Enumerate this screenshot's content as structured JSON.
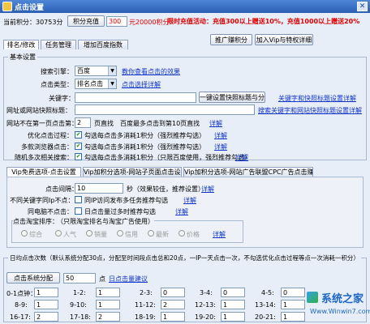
{
  "window": {
    "title": "点击设置",
    "close_glyph": "✕"
  },
  "top": {
    "points_label": "当前积分：30753分",
    "recharge_button": "积分充值",
    "recharge_amount": "300",
    "recharge_unit": "元20000积分",
    "promo": "限时充值活动：充值300以上赠送10%，充值1000以上赠送20%",
    "promo_software_button": "推广赚积分",
    "add_vip_button": "加入Vip与特权详细"
  },
  "tabs": [
    "排名/修改",
    "任务管理",
    "增加百度指数"
  ],
  "basic": {
    "group_label": "基本设置",
    "engine_label": "搜索引擎：",
    "engine_value": "百度",
    "engine_link": "教你查看点击的效果",
    "click_type_label": "点击类型：",
    "click_type_value": "排名点击",
    "click_type_link": "点击选择详解",
    "keyword_label": "关键字：",
    "keyword_button": "一键设置快照标题与分页",
    "keyword_link": "关键字和快照标题设置详解",
    "title_label": "网址或网站快照标题：",
    "title_link": "搜索关键字和网站快照标题设置详解",
    "pages_label": "网站不在第一页点击第：",
    "pages_value": "2",
    "pages_suffix": "页直找　百度最多点击到第10页直找",
    "pages_link": "详解",
    "optimize_label": "优化点击过程：",
    "optimize_text": "勾选每点击多消耗1积分（强烈推荐勾选）",
    "optimize_link": "详解",
    "multi_browser_label": "多款浏览器点击：",
    "multi_browser_text": "勾选每点击多消耗1积分（强烈推荐勾选）",
    "multi_browser_link": "详解",
    "random_label": "随机多次相关搜索：",
    "random_text": "勾选每点击多消耗1积分（只限百度使用，强烈推荐勾选）",
    "random_link": "详解",
    "check_glyph": "✔"
  },
  "vip_tabs": [
    "Vip免费选项-点击设置",
    "Vip加积分选项-网站子页面点击设置",
    "Vip加积分选项-网站广告联盟CPC广告点击赚钱"
  ],
  "vip": {
    "dwell_label": "点击间隔：",
    "dwell_value": "10",
    "dwell_suffix": "秒（效果较佳，推荐设置）",
    "dwell_link": "详解",
    "ip_label": "不同关键字同Ip不点：",
    "ip_text": "同IP访问发布多任务推荐勾选",
    "ip_link": "详解",
    "sameday_label": "同电脑不点击：",
    "sameday_text": "日点击量过多时推荐勾选",
    "sameday_link": "详解",
    "sort_label": "点击淘宝排序：",
    "sort_note": "（只限淘宝排名与淘宝广告使用）",
    "sort_options": [
      "综合",
      "人气",
      "销量",
      "信用",
      "最新",
      "价格"
    ],
    "sort_link": "详解"
  },
  "daily": {
    "group_label": "日均点击次数（默认系统分配30点，分配至时间段点击总和20点，一IP一天点击一次，不勾选优化点击过程等点一次消耗一积分）",
    "auto_button": "点击系统分配",
    "auto_value": "50",
    "auto_suffix": "点",
    "auto_link": "日点击量建议",
    "slots": [
      {
        "label": "0-1点钟：",
        "value": "1"
      },
      {
        "label": "1-2:",
        "value": "1"
      },
      {
        "label": "2-3:",
        "value": "0"
      },
      {
        "label": "3-4:",
        "value": "0"
      },
      {
        "label": "4-5:",
        "value": "0"
      },
      {
        "label": "8-9:",
        "value": "1"
      },
      {
        "label": "9-10:",
        "value": "1"
      },
      {
        "label": "11-12:",
        "value": "2"
      },
      {
        "label": "12-13:",
        "value": "1"
      },
      {
        "label": "13-14:",
        "value": "1"
      },
      {
        "label": "16-17:",
        "value": "2"
      },
      {
        "label": "17-18:",
        "value": "2"
      },
      {
        "label": "18-19:",
        "value": "1"
      },
      {
        "label": "19-20:",
        "value": "1"
      },
      {
        "label": "20-21:",
        "value": "1"
      }
    ]
  },
  "watermark": {
    "site": "系统之家",
    "url": "Www.Winwin7.com"
  },
  "colors": {
    "titlebar": "#2a5fb5",
    "promo": "#e00000",
    "link": "#1136c9",
    "background": "#e8eef7"
  }
}
